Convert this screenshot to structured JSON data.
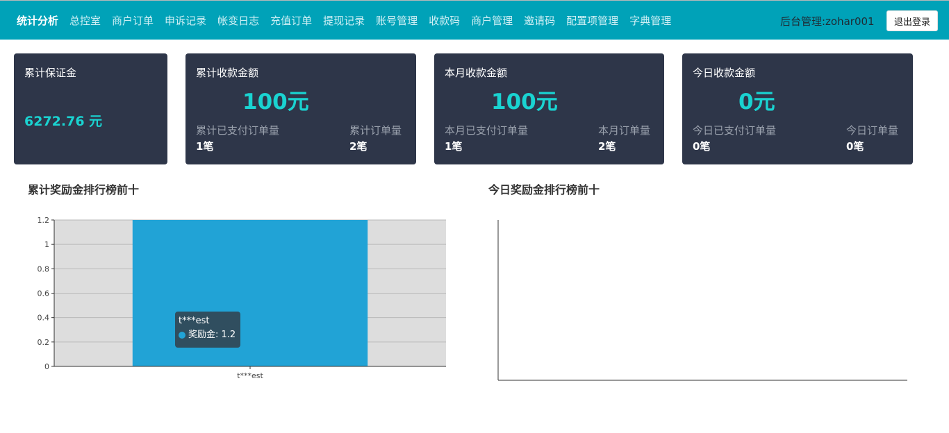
{
  "nav": {
    "items": [
      {
        "label": "统计分析",
        "active": true
      },
      {
        "label": "总控室"
      },
      {
        "label": "商户订单"
      },
      {
        "label": "申诉记录"
      },
      {
        "label": "帐变日志"
      },
      {
        "label": "充值订单"
      },
      {
        "label": "提现记录"
      },
      {
        "label": "账号管理"
      },
      {
        "label": "收款码"
      },
      {
        "label": "商户管理"
      },
      {
        "label": "邀请码"
      },
      {
        "label": "配置项管理"
      },
      {
        "label": "字典管理"
      }
    ],
    "user_label": "后台管理:zohar001",
    "logout_label": "退出登录"
  },
  "cards": {
    "deposit": {
      "title": "累计保证金",
      "value": "6272.76 元"
    },
    "total": {
      "title": "累计收款金额",
      "amount": "100元",
      "paid_label": "累计已支付订单量",
      "paid_value": "1笔",
      "orders_label": "累计订单量",
      "orders_value": "2笔"
    },
    "month": {
      "title": "本月收款金额",
      "amount": "100元",
      "paid_label": "本月已支付订单量",
      "paid_value": "1笔",
      "orders_label": "本月订单量",
      "orders_value": "2笔"
    },
    "today": {
      "title": "今日收款金额",
      "amount": "0元",
      "paid_label": "今日已支付订单量",
      "paid_value": "0笔",
      "orders_label": "今日订单量",
      "orders_value": "0笔"
    }
  },
  "sections": {
    "left_title": "累计奖励金排行榜前十",
    "right_title": "今日奖励金排行榜前十"
  },
  "tooltip": {
    "name": "t***est",
    "series": "奖励金",
    "value": "1.2",
    "text": "奖励金: 1.2"
  },
  "colors": {
    "accent": "#00a2b8",
    "card_bg": "#2e3649",
    "highlight": "#1ad3d1",
    "bar": "#21a3d6",
    "plot_bg": "#dddddd"
  },
  "chart_data": [
    {
      "type": "bar",
      "title": "累计奖励金排行榜前十",
      "categories": [
        "t***est"
      ],
      "series": [
        {
          "name": "奖励金",
          "values": [
            1.2
          ]
        }
      ],
      "yticks": [
        "0",
        "0.2",
        "0.4",
        "0.6",
        "0.8",
        "1",
        "1.2"
      ],
      "ylim": [
        0,
        1.2
      ],
      "grid": true
    },
    {
      "type": "bar",
      "title": "今日奖励金排行榜前十",
      "categories": [],
      "series": [],
      "grid": false
    }
  ]
}
